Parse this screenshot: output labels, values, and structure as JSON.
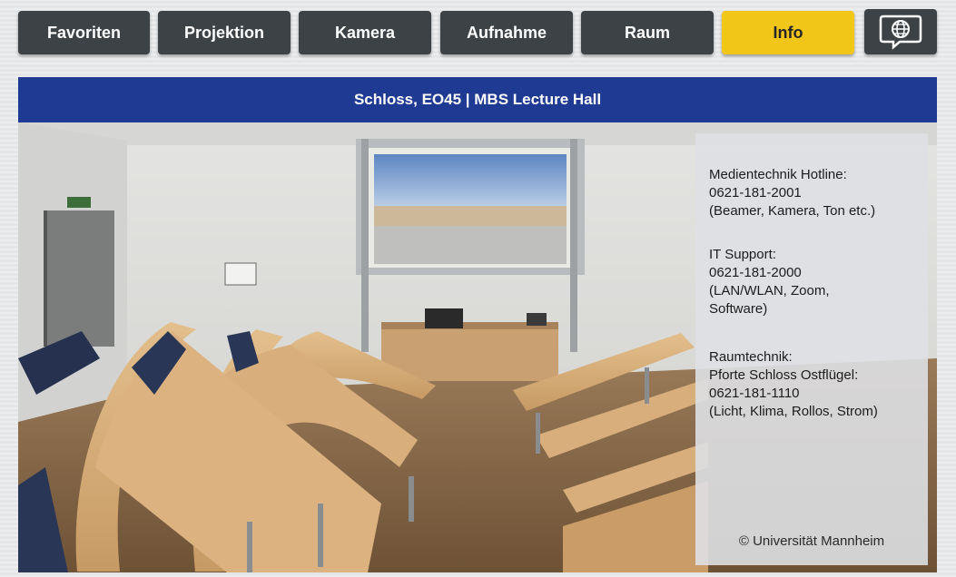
{
  "nav": {
    "tabs": [
      {
        "label": "Favoriten",
        "active": false
      },
      {
        "label": "Projektion",
        "active": false
      },
      {
        "label": "Kamera",
        "active": false
      },
      {
        "label": "Aufnahme",
        "active": false
      },
      {
        "label": "Raum",
        "active": false
      },
      {
        "label": "Info",
        "active": true
      }
    ],
    "language_icon": "globe-speech-bubble-icon"
  },
  "room_title": "Schloss, EO45 | MBS Lecture Hall",
  "info": {
    "media": {
      "heading": "Medientechnik Hotline:",
      "phone": "0621-181-2001",
      "note": "(Beamer, Kamera, Ton etc.)"
    },
    "it": {
      "heading": "IT Support:",
      "phone": "0621-181-2000",
      "note1": "(LAN/WLAN, Zoom,",
      "note2": "Software)"
    },
    "room": {
      "heading": "Raumtechnik:",
      "contact": "Pforte Schloss Ostflügel:",
      "phone": "0621-181-1110",
      "note": "(Licht, Klima, Rollos, Strom)"
    },
    "copyright": "© Universität Mannheim"
  },
  "colors": {
    "nav_bg": "#3d4246",
    "nav_active": "#f2c619",
    "title_bar": "#1f3a93"
  }
}
